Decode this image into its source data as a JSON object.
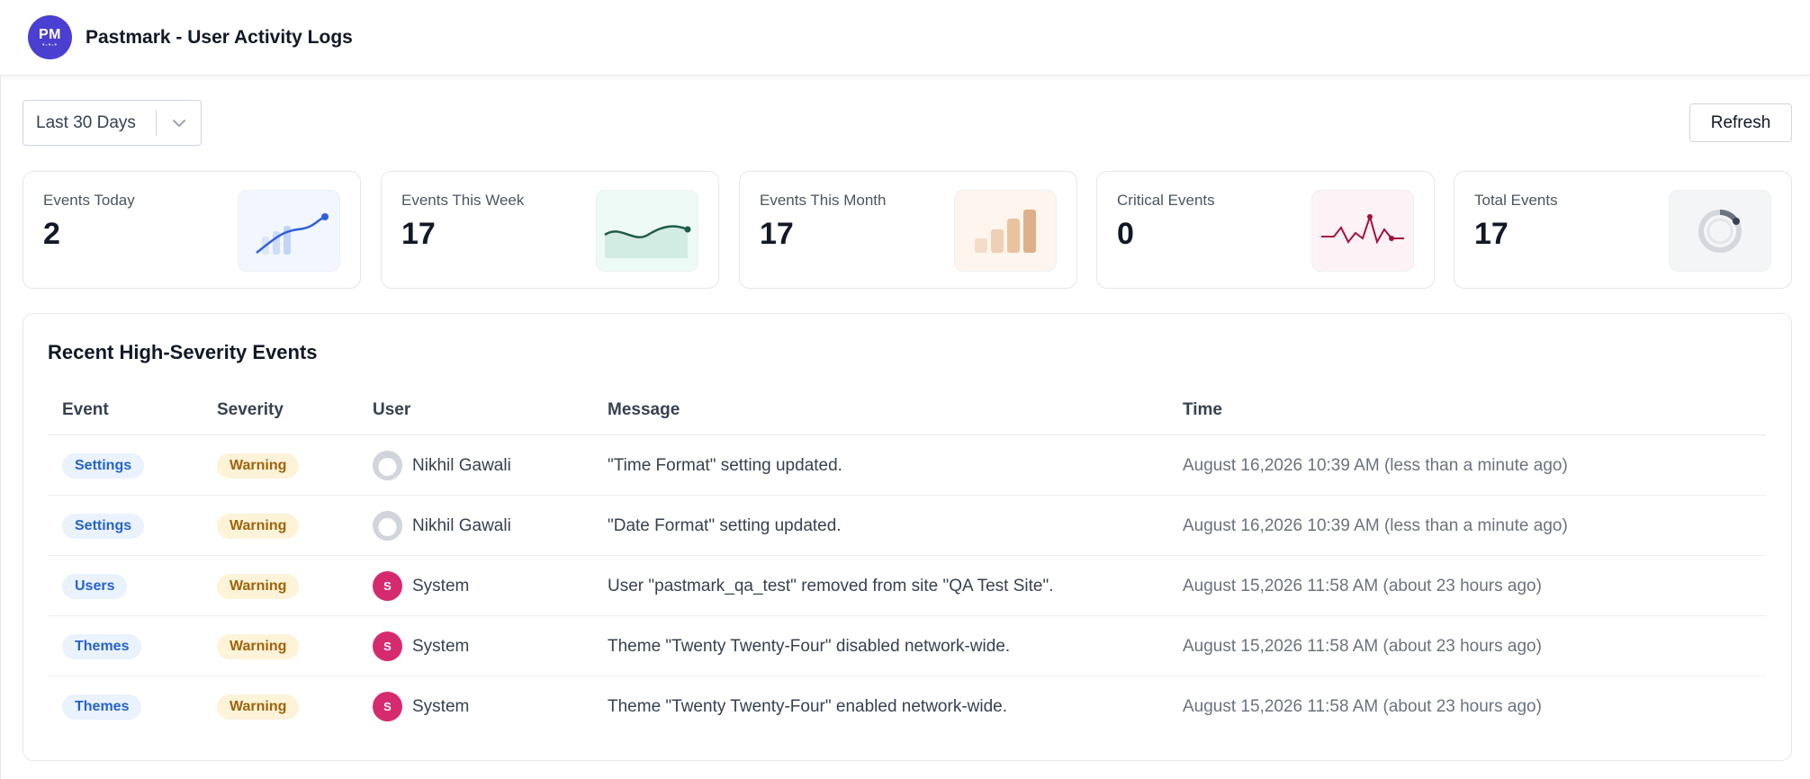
{
  "header": {
    "logo_text": "PM",
    "title": "Pastmark - User Activity Logs"
  },
  "toolbar": {
    "range_value": "Last 30 Days",
    "refresh_label": "Refresh"
  },
  "stats": [
    {
      "label": "Events Today",
      "value": "2",
      "chart_icon": "line-chart-icon",
      "tint": "#f2f6fe"
    },
    {
      "label": "Events This Week",
      "value": "17",
      "chart_icon": "area-chart-icon",
      "tint": "#eefaf5"
    },
    {
      "label": "Events This Month",
      "value": "17",
      "chart_icon": "bar-chart-icon",
      "tint": "#fdf5ee"
    },
    {
      "label": "Critical Events",
      "value": "0",
      "chart_icon": "pulse-chart-icon",
      "tint": "#fdf2f5"
    },
    {
      "label": "Total Events",
      "value": "17",
      "chart_icon": "ring-chart-icon",
      "tint": "#f4f5f7"
    }
  ],
  "panel": {
    "title": "Recent High-Severity Events",
    "columns": {
      "event": "Event",
      "severity": "Severity",
      "user": "User",
      "message": "Message",
      "time": "Time"
    },
    "rows": [
      {
        "event": "Settings",
        "severity": "Warning",
        "user": "Nikhil Gawali",
        "avatar": "person",
        "avatar_text": "",
        "message": "\"Time Format\" setting updated.",
        "time": "August 16,2026 10:39 AM (less than a minute ago)"
      },
      {
        "event": "Settings",
        "severity": "Warning",
        "user": "Nikhil Gawali",
        "avatar": "person",
        "avatar_text": "",
        "message": "\"Date Format\" setting updated.",
        "time": "August 16,2026 10:39 AM (less than a minute ago)"
      },
      {
        "event": "Users",
        "severity": "Warning",
        "user": "System",
        "avatar": "system",
        "avatar_text": "S",
        "message": "User \"pastmark_qa_test\" removed from site \"QA Test Site\".",
        "time": "August 15,2026 11:58 AM (about 23 hours ago)"
      },
      {
        "event": "Themes",
        "severity": "Warning",
        "user": "System",
        "avatar": "system",
        "avatar_text": "S",
        "message": "Theme \"Twenty Twenty-Four\" disabled network-wide.",
        "time": "August 15,2026 11:58 AM (about 23 hours ago)"
      },
      {
        "event": "Themes",
        "severity": "Warning",
        "user": "System",
        "avatar": "system",
        "avatar_text": "S",
        "message": "Theme \"Twenty Twenty-Four\" enabled network-wide.",
        "time": "August 15,2026 11:58 AM (about 23 hours ago)"
      }
    ]
  }
}
